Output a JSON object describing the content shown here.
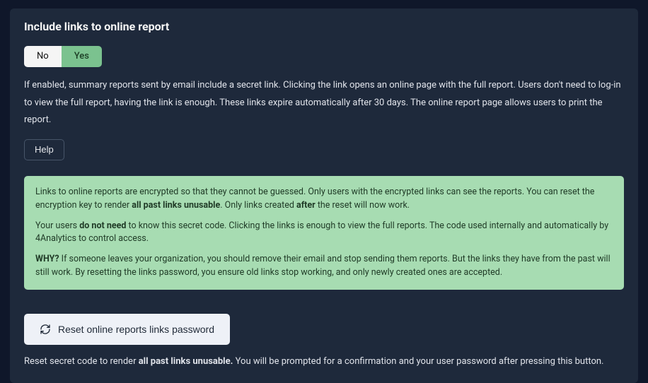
{
  "title": "Include links to online report",
  "toggle": {
    "no": "No",
    "yes": "Yes"
  },
  "description": "If enabled, summary reports sent by email include a secret link. Clicking the link opens an online page with the full report. Users don't need to log-in to view the full report, having the link is enough. These links expire automatically after 30 days. The online report page allows users to print the report.",
  "help_label": "Help",
  "info": {
    "p1_a": "Links to online reports are encrypted so that they cannot be guessed. Only users with the encrypted links can see the reports. You can reset the encryption key to render ",
    "p1_b_bold": "all past links unusable",
    "p1_c": ". Only links created ",
    "p1_d_bold": "after",
    "p1_e": " the reset will now work.",
    "p2_a": "Your users ",
    "p2_b_bold": "do not need",
    "p2_c": " to know this secret code. Clicking the links is enough to view the full reports. The code used internally and automatically by 4Analytics to control access.",
    "p3_a_bold": "WHY?",
    "p3_b": " If someone leaves your organization, you should remove their email and stop sending them reports. But the links they have from the past will still work. By resetting the links password, you ensure old links stop working, and only newly created ones are accepted."
  },
  "reset_button_label": "Reset online reports links password",
  "footer": {
    "a": "Reset secret code to render ",
    "b_bold": "all past links unusable.",
    "c": " You will be prompted for a confirmation and your user password after pressing this button."
  }
}
